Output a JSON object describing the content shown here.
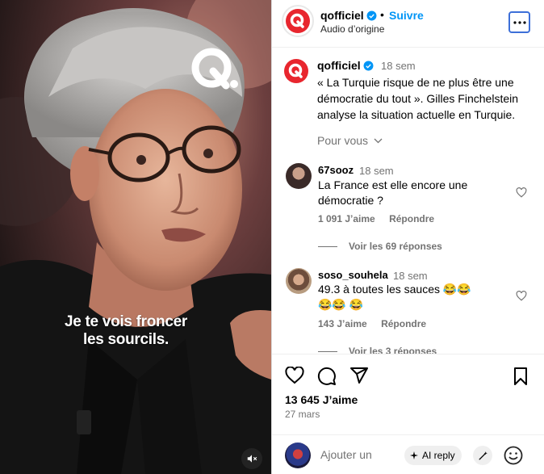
{
  "video": {
    "caption_line1": "Je te vois froncer",
    "caption_line2": "les sourcils.",
    "logo": "Q."
  },
  "header": {
    "username": "qofficiel",
    "dot": "•",
    "follow_label": "Suivre",
    "audio": "Audio d’origine"
  },
  "post": {
    "username": "qofficiel",
    "time": "18 sem",
    "text": "« La Turquie risque de ne plus être une démocratie du tout ». Gilles Finchelstein analyse la situation actuelle en Turquie.",
    "see_translation": "Pour vous"
  },
  "comments": [
    {
      "username": "67sooz",
      "time": "18 sem",
      "text": "La France est elle encore une démocratie ?",
      "likes": "1 091 J’aime",
      "reply": "Répondre",
      "replies": "Voir les 69 réponses"
    },
    {
      "username": "soso_souhela",
      "time": "18 sem",
      "text": "49.3 à toutes les sauces 😂😂😂😂 😂",
      "likes": "143 J’aime",
      "reply": "Répondre",
      "replies": "Voir les 3 réponses"
    }
  ],
  "footer": {
    "likes": "13 645 J’aime",
    "date": "27 mars",
    "composer_placeholder": "Ajouter un",
    "ai_reply": "AI reply"
  },
  "colors": {
    "brand_red": "#e8262e",
    "follow_blue": "#0095f6",
    "verified_blue": "#0095f6"
  },
  "icons": [
    "heart-icon",
    "comment-icon",
    "share-icon",
    "bookmark-icon",
    "more-icon",
    "mute-icon",
    "verified-icon",
    "sparkle-icon",
    "wand-icon",
    "emoji-icon",
    "chevron-down-icon"
  ]
}
